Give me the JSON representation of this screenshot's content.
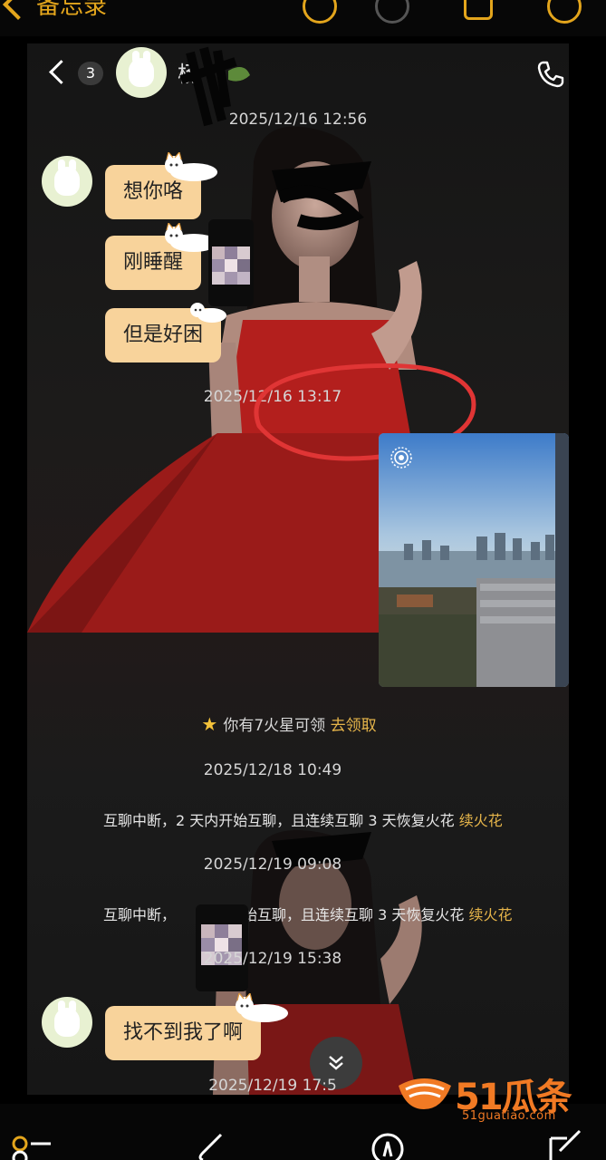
{
  "notes_app": {
    "back_label": "备忘录"
  },
  "chat": {
    "unread_badge": "3",
    "contact_name": "杨",
    "timestamps": [
      "2025/12/16 12:56",
      "2025/12/16 13:17",
      "2025/12/18 10:49",
      "2025/12/19 09:08",
      "2025/12/19 15:38",
      "2025/12/19 17:5"
    ],
    "messages": [
      {
        "text": "想你咯"
      },
      {
        "text": "刚睡醒"
      },
      {
        "text": "但是好困"
      },
      {
        "text": "找不到我了啊"
      }
    ],
    "star_notice": {
      "text": "你有7火星可领",
      "action": "去领取"
    },
    "system_messages": [
      {
        "text": "互聊中断，2 天内开始互聊，且连续互聊 3 天恢复火花",
        "action": "续火花"
      },
      {
        "text_left": "互聊中断，",
        "text_right": "始互聊，且连续互聊 3 天恢复火花",
        "action": "续火花"
      }
    ]
  },
  "watermark": {
    "brand": "51瓜条",
    "url": "51guatiao.com"
  },
  "colors": {
    "bubble": "#f8d39b",
    "accent_gold": "#e6b54a",
    "notes_orange": "#e3a51c",
    "annotation_red": "#e03535",
    "watermark_orange": "#f17a24"
  }
}
